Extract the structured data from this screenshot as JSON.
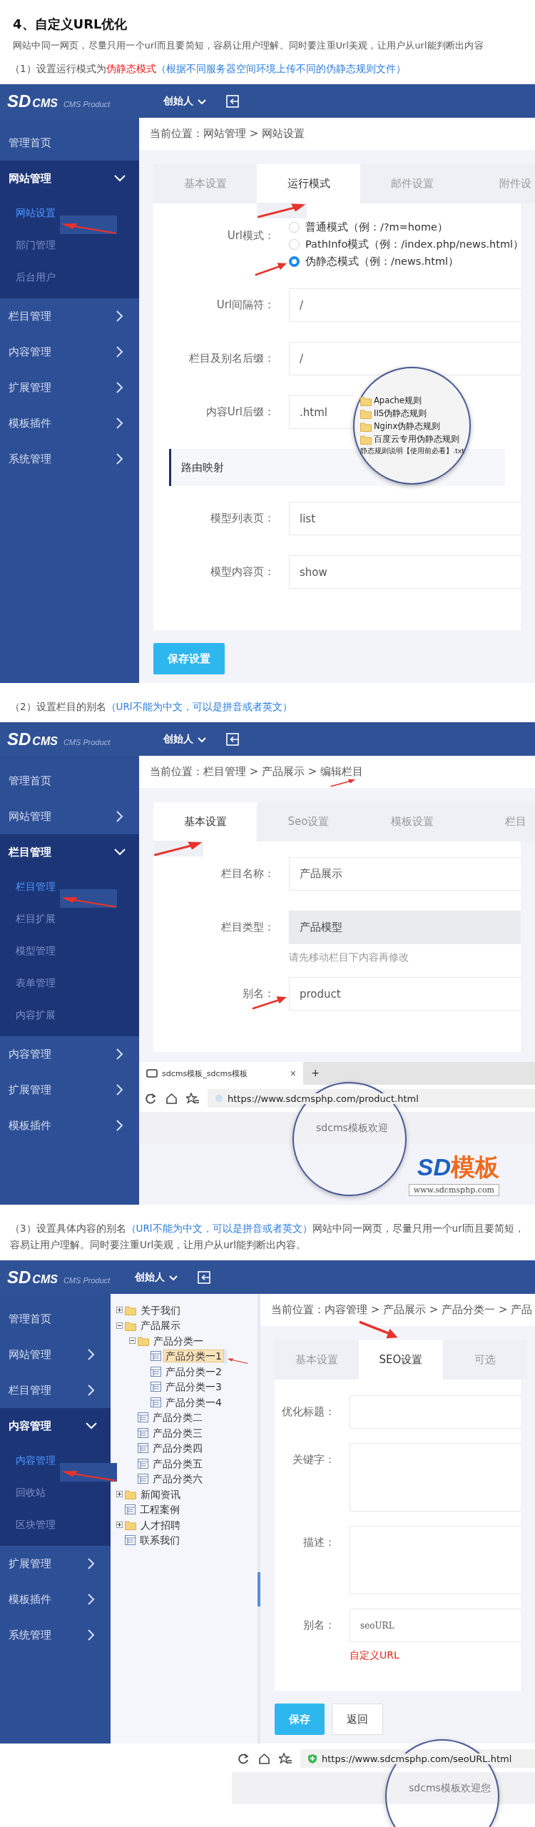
{
  "heading": "4、自定义URL优化",
  "intro": "网站中同一网页，尽量只用一个url而且要简短，容易让用户理解。同时要注重Url美观，让用户从url能判断出内容",
  "sections": [
    {
      "caption": [
        {
          "text": "（1）设置运行模式为",
          "color": "#555555"
        },
        {
          "text": "伪静态模式",
          "color": "#f01818"
        },
        {
          "text": "（根据不同服务器空间环境上传不同的伪静态规则文件）",
          "color": "#2b7de0"
        }
      ],
      "screen": {
        "header": {
          "logo": "SD",
          "logo_accent": "CMS",
          "tagline": "CMS Product",
          "user": "创始人"
        },
        "sidebar": [
          {
            "kind": "link",
            "label": "管理首页"
          },
          {
            "kind": "group",
            "label": "网站管理",
            "expanded": true,
            "children": [
              {
                "label": "网站设置",
                "selected": true,
                "annotated": true
              },
              {
                "label": "部门管理",
                "selected": false,
                "annotated": false
              },
              {
                "label": "后台用户",
                "selected": false,
                "annotated": false
              }
            ]
          },
          {
            "kind": "group",
            "label": "栏目管理",
            "expanded": false
          },
          {
            "kind": "group",
            "label": "内容管理",
            "expanded": false
          },
          {
            "kind": "group",
            "label": "扩展管理",
            "expanded": false
          },
          {
            "kind": "group",
            "label": "模板插件",
            "expanded": false
          },
          {
            "kind": "group",
            "label": "系统管理",
            "expanded": false
          }
        ],
        "breadcrumb": {
          "text": "当前位置：网站管理 > 网站设置",
          "annotated": false
        },
        "tabs": [
          {
            "label": "基本设置",
            "selected": false,
            "annotated": false
          },
          {
            "label": "运行模式",
            "selected": true,
            "annotated": true
          },
          {
            "label": "邮件设置",
            "selected": false,
            "annotated": false
          },
          {
            "label": "附件设",
            "selected": false,
            "annotated": false
          }
        ],
        "fields": [
          {
            "kind": "radio",
            "label": "Url模式：",
            "annotated": false,
            "options": [
              {
                "label": "普通模式（例：/?m=home）",
                "selected": false,
                "annotated": false
              },
              {
                "label": "PathInfo模式（例：/index.php/news.html）",
                "selected": false,
                "annotated": false
              },
              {
                "label": "伪静态模式（例：/news.html）",
                "selected": true,
                "annotated": true
              }
            ]
          },
          {
            "kind": "input",
            "label": "Url间隔符：",
            "value": "/",
            "disabled": false,
            "annotated": false
          },
          {
            "kind": "input",
            "label": "栏目及别名后缀：",
            "value": "/",
            "disabled": false,
            "annotated": false
          },
          {
            "kind": "input",
            "label": "内容Url后缀：",
            "value": ".html",
            "disabled": false,
            "annotated": false,
            "lens": {
              "items": [
                {
                  "kind": "folder",
                  "label": "Apache规则"
                },
                {
                  "kind": "folder",
                  "label": "IIS伪静态规则"
                },
                {
                  "kind": "folder",
                  "label": "Nginx伪静态规则"
                },
                {
                  "kind": "folder",
                  "label": "百度云专用伪静态规则"
                },
                {
                  "kind": "file",
                  "label": "静态规则说明【使用前必看】.txt"
                }
              ]
            }
          },
          {
            "kind": "section",
            "label": "路由映射",
            "annotated": false
          },
          {
            "kind": "input",
            "label": "模型列表页：",
            "value": "list",
            "disabled": false,
            "annotated": false
          },
          {
            "kind": "input",
            "label": "模型内容页：",
            "value": "show",
            "disabled": false,
            "annotated": false
          }
        ],
        "buttons": [
          {
            "kind": "primary",
            "label": "保存设置"
          }
        ]
      }
    },
    {
      "caption": [
        {
          "text": "（2）设置栏目的别名",
          "color": "#555555"
        },
        {
          "text": "（URl不能为中文，可以是拼音或者英文）",
          "color": "#2b7de0"
        }
      ],
      "screen": {
        "header": {
          "logo": "SD",
          "logo_accent": "CMS",
          "tagline": "CMS Product",
          "user": "创始人"
        },
        "sidebar": [
          {
            "kind": "link",
            "label": "管理首页"
          },
          {
            "kind": "group",
            "label": "网站管理",
            "expanded": false
          },
          {
            "kind": "group",
            "label": "栏目管理",
            "expanded": true,
            "children": [
              {
                "label": "栏目管理",
                "selected": true,
                "annotated": true
              },
              {
                "label": "栏目扩展",
                "selected": false,
                "annotated": false
              },
              {
                "label": "模型管理",
                "selected": false,
                "annotated": false
              },
              {
                "label": "表单管理",
                "selected": false,
                "annotated": false
              },
              {
                "label": "内容扩展",
                "selected": false,
                "annotated": false
              }
            ]
          },
          {
            "kind": "group",
            "label": "内容管理",
            "expanded": false
          },
          {
            "kind": "group",
            "label": "扩展管理",
            "expanded": false
          },
          {
            "kind": "group",
            "label": "模板插件",
            "expanded": false
          }
        ],
        "breadcrumb": {
          "text": "当前位置：栏目管理 > 产品展示 > 编辑栏目",
          "annotated": true
        },
        "tabs": [
          {
            "label": "基本设置",
            "selected": true,
            "annotated": true
          },
          {
            "label": "Seo设置",
            "selected": false,
            "annotated": false
          },
          {
            "label": "模板设置",
            "selected": false,
            "annotated": false
          },
          {
            "label": "栏目",
            "selected": false,
            "annotated": false
          }
        ],
        "fields": [
          {
            "kind": "input",
            "label": "栏目名称：",
            "value": "产品展示",
            "disabled": false,
            "annotated": false
          },
          {
            "kind": "input",
            "label": "栏目类型：",
            "value": "产品模型",
            "disabled": true,
            "annotated": false
          },
          {
            "kind": "hint",
            "text": "请先移动栏目下内容再修改",
            "color": "#999999"
          },
          {
            "kind": "input",
            "label": "别名：",
            "value": "product",
            "disabled": false,
            "annotated": true
          }
        ],
        "browser": {
          "tab_title": "sdcms模板_sdcms模板",
          "close": "×",
          "new_tab": "+",
          "url": "https://www.sdcmsphp.com/product.html",
          "page_text": "sdcms模板欢迎"
        }
      },
      "brand": {
        "logo_left": "SD",
        "logo_right": "模板",
        "url": "www.sdcmsphp.com"
      }
    },
    {
      "caption": [
        {
          "text": "（3）设置具体内容的别名",
          "color": "#555555"
        },
        {
          "text": "（URl不能为中文，可以是拼音或者英文）",
          "color": "#2b7de0"
        },
        {
          "text": "网站中同一网页，尽量只用一个url而且要简短，容易让用户理解。同时要注重Url美观，让用户从url能判断出内容。",
          "color": "#555555"
        }
      ],
      "screen": {
        "header": {
          "logo": "SD",
          "logo_accent": "CMS",
          "tagline": "CMS Product",
          "user": "创始人"
        },
        "sidebar": [
          {
            "kind": "link",
            "label": "管理首页"
          },
          {
            "kind": "group",
            "label": "网站管理",
            "expanded": false
          },
          {
            "kind": "group",
            "label": "栏目管理",
            "expanded": false
          },
          {
            "kind": "group",
            "label": "内容管理",
            "expanded": true,
            "children": [
              {
                "label": "内容管理",
                "selected": true,
                "annotated": true
              },
              {
                "label": "回收站",
                "selected": false,
                "annotated": false
              },
              {
                "label": "区块管理",
                "selected": false,
                "annotated": false
              }
            ]
          },
          {
            "kind": "group",
            "label": "扩展管理",
            "expanded": false
          },
          {
            "kind": "group",
            "label": "模板插件",
            "expanded": false
          },
          {
            "kind": "group",
            "label": "系统管理",
            "expanded": false
          }
        ],
        "tree": [
          {
            "kind": "folder",
            "label": "关于我们",
            "expanded": false,
            "selected": false,
            "annotated": false
          },
          {
            "kind": "folder",
            "label": "产品展示",
            "expanded": true,
            "selected": false,
            "annotated": false,
            "children": [
              {
                "kind": "folder",
                "label": "产品分类一",
                "expanded": true,
                "selected": false,
                "annotated": false,
                "children": [
                  {
                    "kind": "page",
                    "label": "产品分类一1",
                    "selected": true,
                    "annotated": true
                  },
                  {
                    "kind": "page",
                    "label": "产品分类一2",
                    "selected": false,
                    "annotated": false
                  },
                  {
                    "kind": "page",
                    "label": "产品分类一3",
                    "selected": false,
                    "annotated": false
                  },
                  {
                    "kind": "page",
                    "label": "产品分类一4",
                    "selected": false,
                    "annotated": false
                  }
                ]
              },
              {
                "kind": "page",
                "label": "产品分类二",
                "selected": false,
                "annotated": false
              },
              {
                "kind": "page",
                "label": "产品分类三",
                "selected": false,
                "annotated": false
              },
              {
                "kind": "page",
                "label": "产品分类四",
                "selected": false,
                "annotated": false
              },
              {
                "kind": "page",
                "label": "产品分类五",
                "selected": false,
                "annotated": false
              },
              {
                "kind": "page",
                "label": "产品分类六",
                "selected": false,
                "annotated": false
              }
            ]
          },
          {
            "kind": "folder",
            "label": "新闻资讯",
            "expanded": false,
            "selected": false,
            "annotated": false
          },
          {
            "kind": "page",
            "label": "工程案例",
            "selected": false,
            "annotated": false
          },
          {
            "kind": "folder",
            "label": "人才招聘",
            "expanded": false,
            "selected": false,
            "annotated": false
          },
          {
            "kind": "page",
            "label": "联系我们",
            "selected": false,
            "annotated": false
          }
        ],
        "breadcrumb": {
          "text": "当前位置：内容管理 > 产品展示 > 产品分类一 > 产品",
          "annotated": false
        },
        "tabs": [
          {
            "label": "基本设置",
            "selected": false,
            "annotated": false
          },
          {
            "label": "SEO设置",
            "selected": true,
            "annotated": true
          },
          {
            "label": "可选",
            "selected": false,
            "annotated": false
          }
        ],
        "fields": [
          {
            "kind": "input",
            "label": "优化标题：",
            "disabled": false,
            "annotated": false
          },
          {
            "kind": "textarea",
            "label": "关键字：",
            "annotated": false
          },
          {
            "kind": "textarea",
            "label": "描述：",
            "annotated": false
          },
          {
            "kind": "input",
            "label": "别名：",
            "value": "seoURL",
            "disabled": false,
            "annotated": false
          },
          {
            "kind": "hint",
            "text": "自定义URL",
            "color": "#e0281e"
          }
        ],
        "buttons": [
          {
            "kind": "primary",
            "label": "保存"
          },
          {
            "kind": "default",
            "label": "返回"
          }
        ]
      },
      "browser": {
        "url": "https://www.sdcmsphp.com/seoURL.html",
        "page_text": "sdcms模板欢迎您"
      }
    }
  ]
}
